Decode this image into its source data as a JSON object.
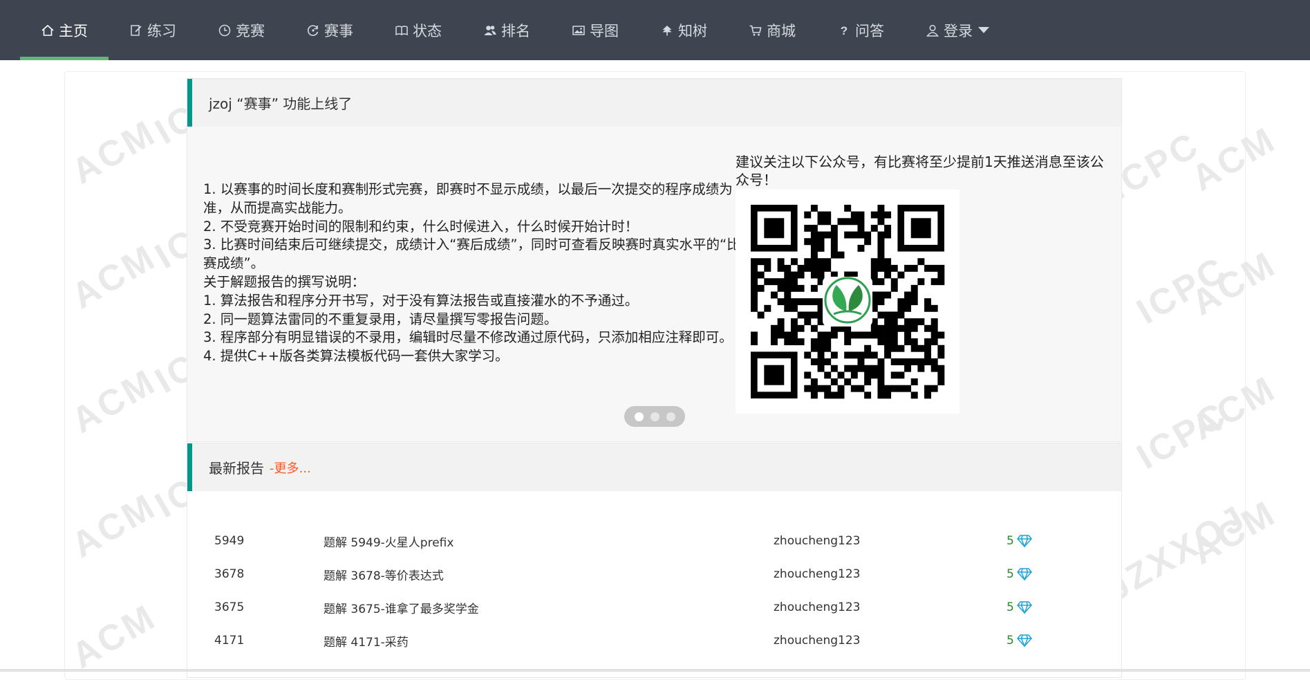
{
  "nav": {
    "items": [
      {
        "label": "主页",
        "icon": "home-icon",
        "active": true
      },
      {
        "label": "练习",
        "icon": "edit-icon"
      },
      {
        "label": "竞赛",
        "icon": "clock-icon"
      },
      {
        "label": "赛事",
        "icon": "refresh-icon"
      },
      {
        "label": "状态",
        "icon": "book-icon"
      },
      {
        "label": "排名",
        "icon": "users-icon"
      },
      {
        "label": "导图",
        "icon": "image-icon"
      },
      {
        "label": "知树",
        "icon": "tree-icon"
      },
      {
        "label": "商城",
        "icon": "cart-icon"
      },
      {
        "label": "问答",
        "icon": "question-icon"
      },
      {
        "label": "登录",
        "icon": "user-icon"
      }
    ]
  },
  "watermark": {
    "text1": "ACM",
    "text2": "ICPC",
    "text3": "JZXXOJ"
  },
  "announcement": {
    "title": "jzoj “赛事” 功能上线了",
    "rules": [
      "1. 以赛事的时间长度和赛制形式完赛，即赛时不显示成绩，以最后一次提交的程序成绩为准，从而提高实战能力。",
      "2. 不受竞赛开始时间的限制和约束，什么时候进入，什么时候开始计时！",
      "3. 比赛时间结束后可继续提交，成绩计入“赛后成绩”，同时可查看反映赛时真实水平的“比赛成绩”。",
      "关于解题报告的撰写说明：",
      "1. 算法报告和程序分开书写，对于没有算法报告或直接灌水的不予通过。",
      "2. 同一题算法雷同的不重复录用，请尽量撰写零报告问题。",
      "3. 程序部分有明显错误的不录用，编辑时尽量不修改通过原代码，只添加相应注释即可。",
      "4. 提供C++版各类算法模板代码一套供大家学习。"
    ],
    "follow_text": "建议关注以下公众号，有比赛将至少提前1天推送消息至该公众号！",
    "carousel_active": 0
  },
  "reports": {
    "title": "最新报告",
    "more_label": "-更多...",
    "rows": [
      {
        "id": "5949",
        "title": "题解 5949-火星人prefix",
        "user": "zhoucheng123",
        "score": "5"
      },
      {
        "id": "3678",
        "title": "题解 3678-等价表达式",
        "user": "zhoucheng123",
        "score": "5"
      },
      {
        "id": "3675",
        "title": "题解 3675-谁拿了最多奖学金",
        "user": "zhoucheng123",
        "score": "5"
      },
      {
        "id": "4171",
        "title": "题解 4171-采药",
        "user": "zhoucheng123",
        "score": "5"
      }
    ]
  },
  "colors": {
    "navbar_bg": "#3e4450",
    "active_underline": "#5fb878",
    "panel_accent": "#009688",
    "more_link": "#ff5722",
    "score_green": "#2a8a2a",
    "diamond": "#1fa3d6"
  }
}
